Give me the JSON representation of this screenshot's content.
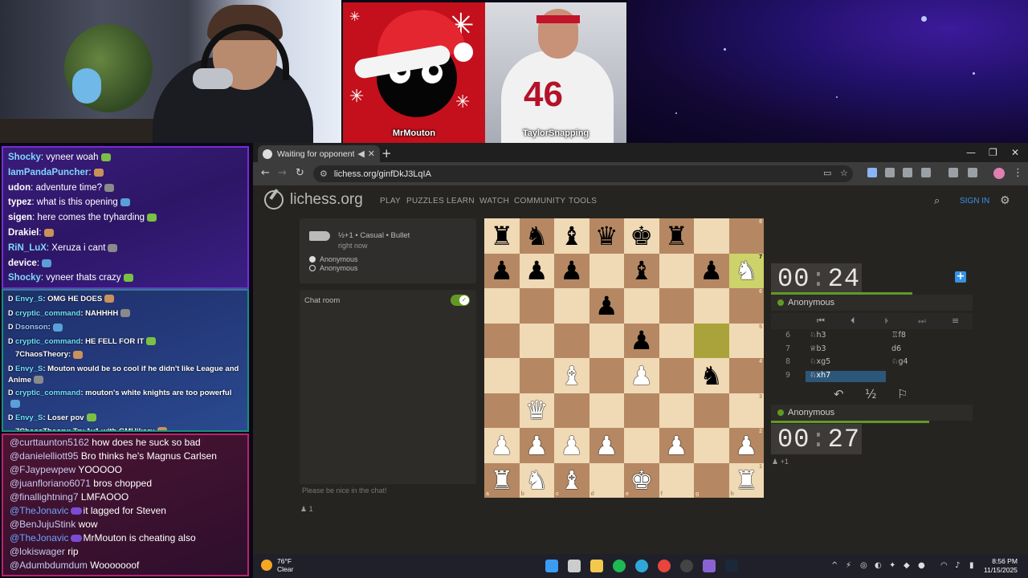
{
  "stream": {
    "players": [
      {
        "name": "MrMouton"
      },
      {
        "name": "TaylorSnapping",
        "jersey_number": "46"
      }
    ]
  },
  "twitch_chat": [
    {
      "user": "Shocky",
      "text": ": vyneer woah",
      "color": "#7fd7ff"
    },
    {
      "user": "IamPandaPuncher",
      "text": ":",
      "color": "#7fd7ff"
    },
    {
      "user": "udon",
      "text": ": adventure time?",
      "color": "#ffffff"
    },
    {
      "user": "typez",
      "text": ": what is this opening",
      "color": "#ffffff"
    },
    {
      "user": "sigen",
      "text": ": here comes the tryharding",
      "color": "#ffffff"
    },
    {
      "user": "Drakiel",
      "text": ":",
      "color": "#ffffff"
    },
    {
      "user": "RiN_LuX",
      "text": ": Xeruza i cant",
      "color": "#7fd7ff"
    },
    {
      "user": "device",
      "text": ":",
      "color": "#ffffff"
    },
    {
      "user": "Shocky",
      "text": ": vyneer thats crazy",
      "color": "#7fd7ff"
    }
  ],
  "kick_chat": [
    {
      "badge": "D",
      "user": "Envy_S",
      "text": ": OMG HE DOES",
      "color": "#6fe0ff"
    },
    {
      "badge": "D",
      "user": "cryptic_command",
      "text": ": NAHHHH",
      "color": "#6fe0ff"
    },
    {
      "badge": "D",
      "user": "Dsonson",
      "text": ":",
      "color": "#9cc3ff"
    },
    {
      "badge": "D",
      "user": "cryptic_command",
      "text": ": HE FELL FOR IT",
      "color": "#6fe0ff"
    },
    {
      "badge": "",
      "user": "7ChaosTheory",
      "text": ":",
      "color": "#ffffff"
    },
    {
      "badge": "D",
      "user": "Envy_S",
      "text": ": Mouton would be so cool if he didn't like League and Anime",
      "color": "#6fe0ff"
    },
    {
      "badge": "D",
      "user": "cryptic_command",
      "text": ": mouton's white knights are too powerful",
      "color": "#6fe0ff"
    },
    {
      "badge": "D",
      "user": "Envy_S",
      "text": ": Loser pov",
      "color": "#6fe0ff"
    },
    {
      "badge": "",
      "user": "7ChaosTheory",
      "text": ": Try 1v1 with GMHikaru",
      "color": "#ffffff"
    }
  ],
  "youtube_chat": [
    {
      "user": "@curttaunton5162",
      "text": "how does he suck so bad",
      "member": false
    },
    {
      "user": "@danielelliott95",
      "text": "Bro thinks he's Magnus Carlsen",
      "member": false
    },
    {
      "user": "@FJaypewpew",
      "text": "YOOOOO",
      "member": false
    },
    {
      "user": "@juanfloriano6071",
      "text": "bros chopped",
      "member": false
    },
    {
      "user": "@finallightning7",
      "text": "LMFAOOO",
      "member": false
    },
    {
      "user": "@TheJonavic",
      "text": "it lagged for Steven",
      "member": true
    },
    {
      "user": "@BenJujuStink",
      "text": "wow",
      "member": false
    },
    {
      "user": "@TheJonavic",
      "text": "MrMouton is cheating also",
      "member": true
    },
    {
      "user": "@lokiswager",
      "text": "rip",
      "member": false
    },
    {
      "user": "@Adumbdumdum",
      "text": "Wooooooof",
      "member": false
    }
  ],
  "browser": {
    "tab_title": "Waiting for opponent - Play",
    "url": "lichess.org/ginfDkJ3LqIA"
  },
  "lichess": {
    "logo": "lichess.org",
    "nav": [
      "PLAY",
      "PUZZLES",
      "LEARN",
      "WATCH",
      "COMMUNITY",
      "TOOLS"
    ],
    "sign_in": "SIGN IN",
    "game": {
      "setup": "½+1 • Casual • Bullet",
      "time": "right now",
      "players": [
        "Anonymous",
        "Anonymous"
      ]
    },
    "chat": {
      "title": "Chat room",
      "enabled": true,
      "placeholder": "Please be nice in the chat!",
      "spectators": "1"
    },
    "board": [
      [
        "r",
        "n",
        "b",
        "q",
        "k",
        "r",
        "",
        ""
      ],
      [
        "p",
        "p",
        "p",
        "",
        "b",
        "",
        "p",
        "N"
      ],
      [
        "",
        "",
        "",
        "p",
        "",
        "",
        "",
        ""
      ],
      [
        "",
        "",
        "",
        "",
        "p",
        "",
        "",
        ""
      ],
      [
        "",
        "",
        "B",
        "",
        "P",
        "",
        "n",
        ""
      ],
      [
        "",
        "Q",
        "",
        "",
        "",
        "",
        "",
        ""
      ],
      [
        "P",
        "P",
        "P",
        "P",
        "",
        "P",
        "",
        "P"
      ],
      [
        "R",
        "N",
        "B",
        "",
        "K",
        "",
        "",
        "R"
      ]
    ],
    "highlight": [
      [
        1,
        7
      ],
      [
        3,
        6
      ]
    ],
    "files": [
      "a",
      "b",
      "c",
      "d",
      "e",
      "f",
      "g",
      "h"
    ],
    "ranks": [
      "8",
      "7",
      "6",
      "5",
      "4",
      "3",
      "2",
      "1"
    ],
    "top_clock": {
      "min": "00",
      "sec": "24",
      "player": "Anonymous"
    },
    "bottom_clock": {
      "min": "00",
      "sec": "27",
      "player": "Anonymous"
    },
    "moves": [
      {
        "n": "6",
        "w": "♘h3",
        "b": "♖f8"
      },
      {
        "n": "7",
        "w": "♕b3",
        "b": "d6"
      },
      {
        "n": "8",
        "w": "♘xg5",
        "b": "♘g4"
      },
      {
        "n": "9",
        "w": "♘xh7",
        "b": ""
      }
    ],
    "watchers": "+1"
  },
  "taskbar": {
    "temp": "76°F",
    "weather": "Clear",
    "time": "8:56 PM",
    "date": "11/15/2025"
  }
}
